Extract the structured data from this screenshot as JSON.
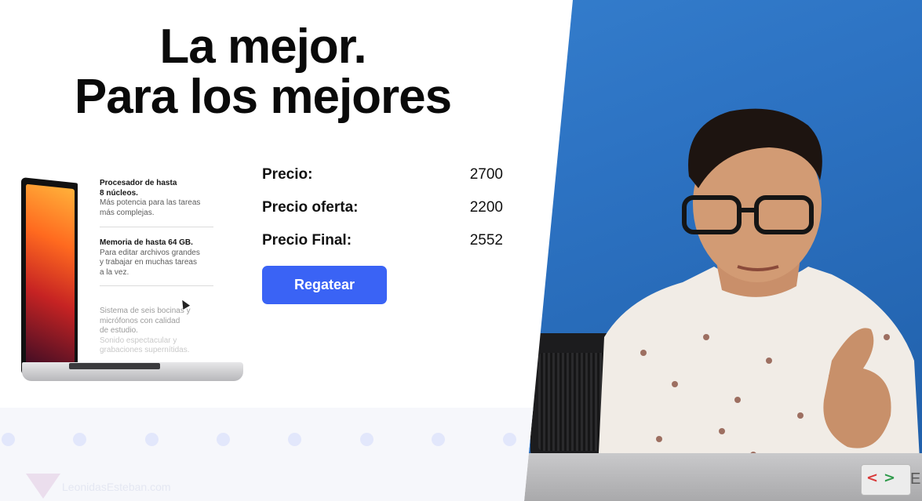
{
  "slide": {
    "headline_line1": "La mejor.",
    "headline_line2": "Para los mejores",
    "features": [
      {
        "title_line1": "Procesador de hasta",
        "title_line2": "8 núcleos.",
        "desc_line1": "Más potencia para las tareas",
        "desc_line2": "más complejas."
      },
      {
        "title_line1": "Memoria de hasta 64 GB.",
        "desc_line1": "Para editar archivos grandes",
        "desc_line2": "y trabajar en muchas tareas",
        "desc_line3": "a la vez."
      },
      {
        "line1": "Sistema de seis bocinas y",
        "line2": "micrófonos con calidad",
        "line3": "de estudio.",
        "line4": "Sonido espectacular y",
        "line5": "grabaciones supernítidas."
      }
    ],
    "prices": [
      {
        "label": "Precio:",
        "value": "2700"
      },
      {
        "label": "Precio oferta:",
        "value": "2200"
      },
      {
        "label": "Precio Final:",
        "value": "2552"
      }
    ],
    "button_label": "Regatear",
    "watermark": "LeonidasEsteban.com"
  },
  "video": {
    "sticker_text": "E"
  },
  "colors": {
    "button": "#3a63f5",
    "background_wall": "#2d73c3"
  }
}
